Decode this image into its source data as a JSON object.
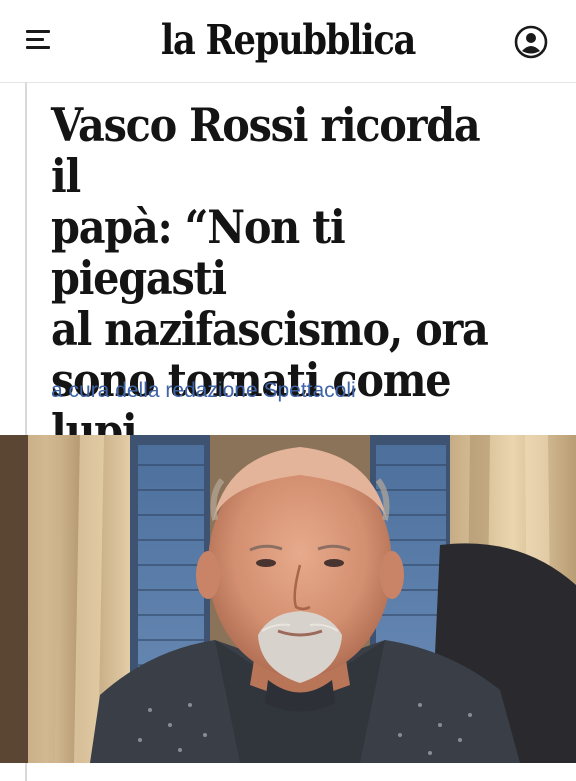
{
  "header": {
    "logo": "la Repubblica",
    "menu_icon": "hamburger-menu-icon",
    "user_icon": "user-account-icon"
  },
  "article": {
    "headline": "Vasco Rossi ricorda il\npapà: “Non ti piegasti\nal nazifascismo, ora\nsono tornati come lupi\ntravestiti da agnelli”",
    "byline": "a cura della redazione Spettacoli",
    "image_subject": "portrait photo of Vasco Rossi"
  },
  "colors": {
    "byline": "#3f63a8",
    "headline": "#141414",
    "divider": "#d9d9d9"
  }
}
